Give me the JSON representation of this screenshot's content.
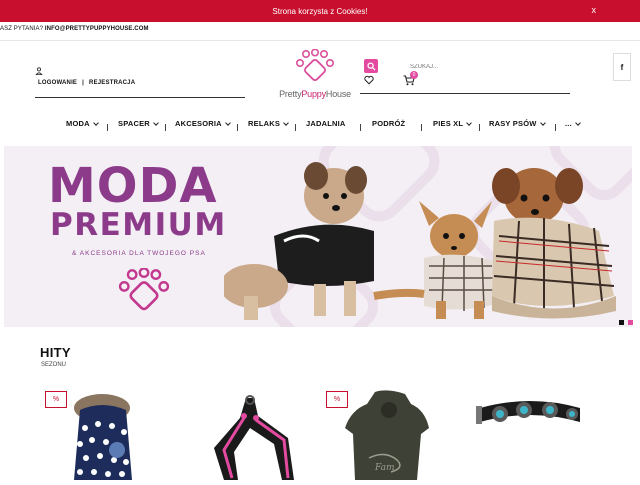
{
  "cookie_bar": {
    "text": "Strona korzysta z Cookies!",
    "close_label": "x"
  },
  "contact": {
    "label": "ASZ PYTANIA?",
    "email": "INFO@PRETTYPUPPYHOUSE.COM"
  },
  "account": {
    "login": "LOGOWANIE",
    "separator": "|",
    "register": "REJESTRACJA"
  },
  "logo": {
    "part1": "Pretty",
    "part2": "Puppy",
    "part3": "House"
  },
  "search": {
    "placeholder": "SZUKAJ..."
  },
  "cart": {
    "count": "0"
  },
  "social": {
    "facebook": "f"
  },
  "nav": {
    "items": [
      {
        "label": "MODA"
      },
      {
        "label": "SPACER"
      },
      {
        "label": "AKCESORIA"
      },
      {
        "label": "RELAKS"
      },
      {
        "label": "JADALNIA"
      },
      {
        "label": "PODRÓŻ"
      },
      {
        "label": "PIES XL"
      },
      {
        "label": "RASY PSÓW"
      },
      {
        "label": "..."
      }
    ]
  },
  "hero": {
    "line1": "MODA",
    "line2": "PREMIUM",
    "line3": "& AKCESORIA DLA TWOJEGO PSA"
  },
  "section": {
    "title": "HITY",
    "subtitle": "SEZONU"
  },
  "products": [
    {
      "badge": "%",
      "icon": "dog-jacket-polka-dot"
    },
    {
      "icon": "dog-harness-pink"
    },
    {
      "badge": "%",
      "icon": "dog-hoodie-olive"
    },
    {
      "icon": "dog-collar-studded"
    }
  ],
  "colors": {
    "brand_red": "#c8102e",
    "accent_pink": "#e34ba0",
    "hero_purple": "#8b3b8a",
    "hero_bg": "#f4eff4"
  }
}
